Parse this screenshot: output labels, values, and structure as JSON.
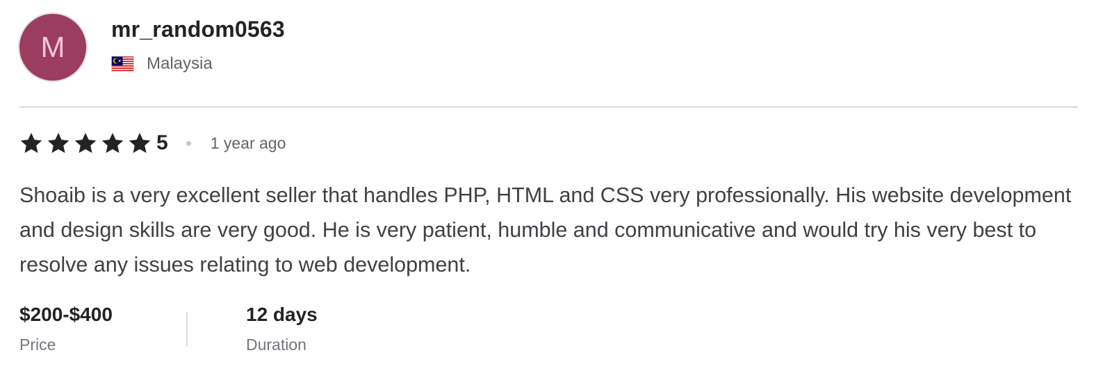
{
  "reviewer": {
    "avatar_letter": "M",
    "avatar_color": "#9b3d5f",
    "avatar_text_color": "#f7c7dc",
    "username": "mr_random0563",
    "country": "Malaysia",
    "flag_icon": "malaysia-flag-icon"
  },
  "rating": {
    "stars": 5,
    "value": "5",
    "time_ago": "1 year ago",
    "star_icon": "star-icon",
    "star_color": "#222325"
  },
  "review": {
    "text": "Shoaib is a very excellent seller that handles PHP, HTML and CSS very professionally. His website development and design skills are very good. He is very patient, humble and communicative and would try his very best to resolve any issues relating to web development."
  },
  "meta": {
    "price_value": "$200-$400",
    "price_label": "Price",
    "duration_value": "12 days",
    "duration_label": "Duration"
  }
}
